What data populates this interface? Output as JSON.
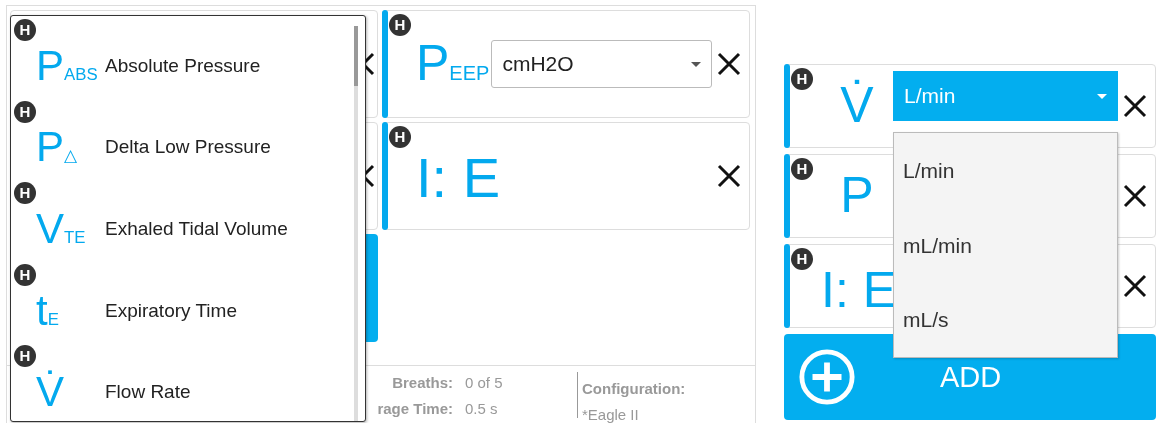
{
  "left_panel": {
    "parameter_cards": [
      {
        "badge": "H",
        "symbol": "P$_{EEP}$",
        "unit_select": {
          "value": "cmH2O",
          "open": false
        }
      },
      {
        "badge": "H",
        "symbol": "I: E"
      }
    ],
    "status": [
      {
        "label": "Breaths:",
        "value": "0 of 5"
      },
      {
        "label": "rage Time:",
        "value": "0.5 s"
      }
    ],
    "configuration": {
      "label": "Configuration:",
      "value": "*Eagle II"
    },
    "parameter_list": {
      "items": [
        {
          "badge": "H",
          "symbol": "P$_{ABS}$",
          "label": "Absolute Pressure"
        },
        {
          "badge": "H",
          "symbol": "P$_{△}$",
          "label": "Delta Low Pressure"
        },
        {
          "badge": "H",
          "symbol": "V$_{TE}$",
          "label": "Exhaled Tidal Volume"
        },
        {
          "badge": "H",
          "symbol": "t$_{E}$",
          "label": "Expiratory Time"
        },
        {
          "badge": "H",
          "symbol": "V̇",
          "label": "Flow Rate"
        }
      ]
    }
  },
  "right_panel": {
    "parameter_cards": [
      {
        "badge": "H",
        "symbol": "V̇",
        "unit_select": {
          "value": "L/min",
          "open": true
        }
      },
      {
        "badge": "H",
        "symbol": "P"
      },
      {
        "badge": "H",
        "symbol": "I: E"
      }
    ],
    "unit_menu": {
      "options": [
        {
          "label": "L/min",
          "selected": false
        },
        {
          "label": "mL/min",
          "selected": false
        },
        {
          "label": "mL/s",
          "selected": false
        }
      ]
    },
    "add_button": {
      "label": "ADD"
    }
  }
}
